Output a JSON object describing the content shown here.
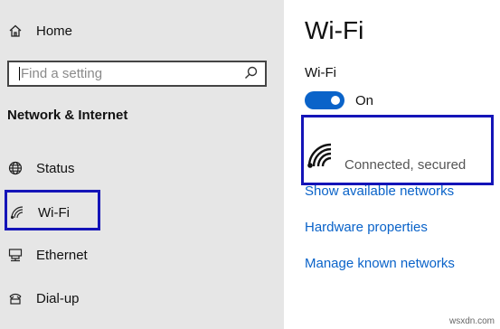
{
  "sidebar": {
    "home_label": "Home",
    "search_placeholder": "Find a setting",
    "section_title": "Network & Internet",
    "items": [
      {
        "label": "Status",
        "icon": "globe-icon"
      },
      {
        "label": "Wi-Fi",
        "icon": "wifi-icon"
      },
      {
        "label": "Ethernet",
        "icon": "ethernet-icon"
      },
      {
        "label": "Dial-up",
        "icon": "dialup-icon"
      }
    ]
  },
  "main": {
    "title": "Wi-Fi",
    "wifi_label": "Wi-Fi",
    "toggle_state": "On",
    "toggle_on": true,
    "connection_status": "Connected, secured",
    "links": {
      "show_networks": "Show available networks",
      "hardware": "Hardware properties",
      "manage_known": "Manage known networks"
    }
  },
  "colors": {
    "accent": "#0a63c9",
    "highlight_box": "#1414b8",
    "sidebar_bg": "#e6e6e6"
  },
  "watermark": "wsxdn.com"
}
